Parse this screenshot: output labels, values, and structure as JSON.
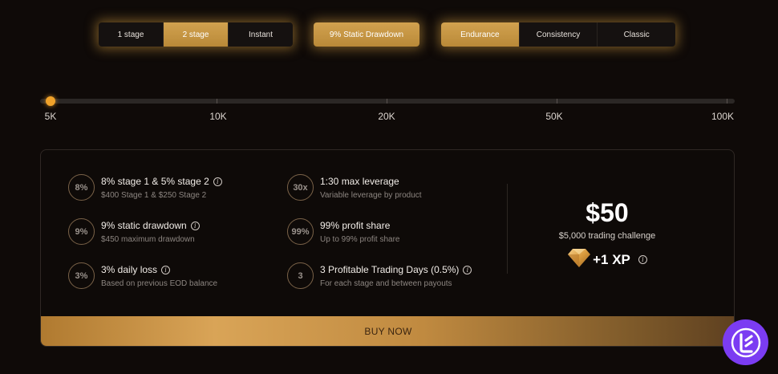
{
  "stage_selector": {
    "options": [
      "1 stage",
      "2 stage",
      "Instant"
    ],
    "selected": "2 stage"
  },
  "drawdown_selector": {
    "label": "9% Static Drawdown"
  },
  "type_selector": {
    "options": [
      "Endurance",
      "Consistency",
      "Classic"
    ],
    "selected": "Endurance"
  },
  "account_size_slider": {
    "labels": [
      "5K",
      "10K",
      "20K",
      "50K",
      "100K"
    ],
    "selected": "5K"
  },
  "features": [
    {
      "badge": "8%",
      "title": "8% stage 1 & 5% stage 2",
      "sub": "$400 Stage 1 & $250 Stage 2",
      "info": true
    },
    {
      "badge": "9%",
      "title": "9% static drawdown",
      "sub": "$450 maximum drawdown",
      "info": true
    },
    {
      "badge": "3%",
      "title": "3% daily loss",
      "sub": "Based on previous EOD balance",
      "info": true
    },
    {
      "badge": "30x",
      "title": "1:30 max leverage",
      "sub": "Variable leverage by product",
      "info": false
    },
    {
      "badge": "99%",
      "title": "99% profit share",
      "sub": "Up to 99% profit share",
      "info": false
    },
    {
      "badge": "3",
      "title": "3 Profitable Trading Days (0.5%)",
      "sub": "For each stage and between payouts",
      "info": true
    }
  ],
  "pricing": {
    "price": "$50",
    "description": "$5,000 trading challenge",
    "xp": "+1 XP"
  },
  "buy_button": {
    "label": "BUY NOW"
  },
  "colors": {
    "accent": "#d2a24f",
    "background": "#0f0a08",
    "logo": "#7b3cf2"
  }
}
